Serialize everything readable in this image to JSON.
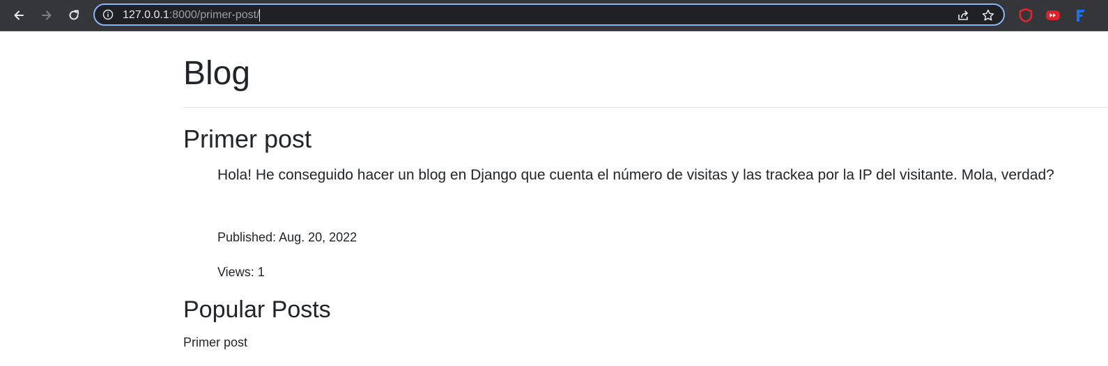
{
  "browser": {
    "url_host": "127.0.0.1",
    "url_path": ":8000/primer-post/"
  },
  "blog": {
    "title": "Blog"
  },
  "post": {
    "title": "Primer post",
    "body": "Hola! He conseguido hacer un blog en Django que cuenta el número de visitas y las trackea por la IP del visitante. Mola, verdad?",
    "published_label": "Published: Aug. 20, 2022",
    "views_label": "Views: 1"
  },
  "popular": {
    "title": "Popular Posts",
    "items": [
      "Primer post"
    ]
  }
}
